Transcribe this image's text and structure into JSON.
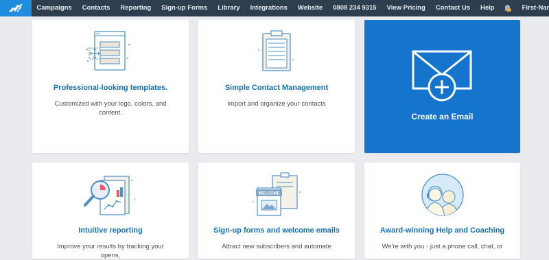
{
  "nav": {
    "logo_icon": "constant-contact-logo-icon",
    "items": [
      {
        "label": "Campaigns"
      },
      {
        "label": "Contacts"
      },
      {
        "label": "Reporting"
      },
      {
        "label": "Sign-up Forms"
      },
      {
        "label": "Library"
      },
      {
        "label": "Integrations"
      },
      {
        "label": "Website"
      },
      {
        "label": "0808 234 9315"
      },
      {
        "label": "View Pricing"
      },
      {
        "label": "Contact Us"
      },
      {
        "label": "Help"
      }
    ],
    "notification_icon": "bell-icon",
    "user_label": "First-Name"
  },
  "cards": [
    {
      "icon": "templates-icon",
      "title": "Professional-looking templates.",
      "description": "Customized with your logo, colors, and content."
    },
    {
      "icon": "clipboard-icon",
      "title": "Simple Contact Management",
      "description": "Import and organize your contacts"
    },
    {
      "icon": "envelope-plus-icon",
      "title": "Create an Email"
    },
    {
      "icon": "reporting-icon",
      "title": "Intuitive reporting",
      "description": "Improve your results by tracking your opens,"
    },
    {
      "icon": "signup-forms-icon",
      "title": "Sign-up forms and welcome emails",
      "description": "Attract new subscribers and automate",
      "badge": "WELCOME"
    },
    {
      "icon": "support-agents-icon",
      "title": "Award-winning Help and Coaching",
      "description": "We're with you - just a phone call, chat, or"
    }
  ],
  "colors": {
    "nav_bg": "#2e3e4e",
    "logo_bg": "#1f8ce0",
    "accent": "#1771b6",
    "cta_bg": "#1574cc",
    "page_bg": "#e9ebee"
  }
}
